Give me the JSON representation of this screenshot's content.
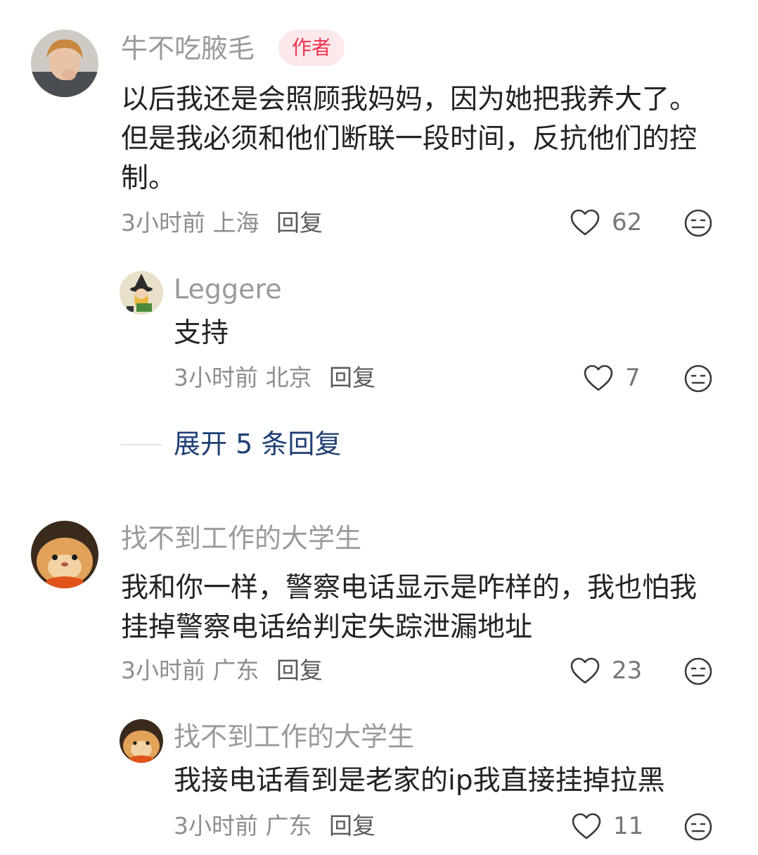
{
  "comments": [
    {
      "author": "牛不吃腋毛",
      "badge": "作者",
      "text": "以后我还是会照顾我妈妈，因为她把我养大了。但是我必须和他们断联一段时间，反抗他们的控制。",
      "time": "3小时前",
      "location": "上海",
      "reply_label": "回复",
      "likes": "62",
      "replies": [
        {
          "author": "Leggere",
          "text": "支持",
          "time": "3小时前",
          "location": "北京",
          "reply_label": "回复",
          "likes": "7"
        }
      ],
      "expand_label": "展开 5 条回复"
    },
    {
      "author": "找不到工作的大学生",
      "text": "我和你一样，警察电话显示是咋样的，我也怕我挂掉警察电话给判定失踪泄漏地址",
      "time": "3小时前",
      "location": "广东",
      "reply_label": "回复",
      "likes": "23",
      "replies": [
        {
          "author": "找不到工作的大学生",
          "text": "我接电话看到是老家的ip我直接挂掉拉黑",
          "time": "3小时前",
          "location": "广东",
          "reply_label": "回复",
          "likes": "11"
        }
      ]
    }
  ],
  "icons": {
    "like": "heart-outline-icon",
    "dislike": "meh-face-icon"
  },
  "colors": {
    "badge_bg": "#fde9ec",
    "badge_text": "#f0334f",
    "expand_link": "#1f3f73"
  }
}
